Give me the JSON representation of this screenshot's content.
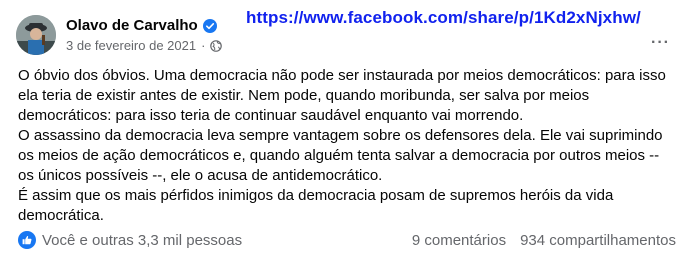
{
  "post": {
    "author": "Olavo de Carvalho",
    "date": "3 de fevereiro de 2021",
    "separator": "·",
    "more_label": "···",
    "paragraphs": [
      "O óbvio dos óbvios. Uma democracia não pode ser instaurada por meios democráticos: para isso ela teria de existir antes de existir. Nem pode, quando moribunda, ser salva por meios democráticos: para isso teria de continuar saudável enquanto vai morrendo.",
      "O assassino da democracia leva sempre vantagem sobre os defensores dela. Ele vai suprimindo os meios de ação democráticos e, quando alguém tenta salvar a democracia por outros meios -- os únicos possíveis --, ele o acusa de antidemocrático.",
      "É assim que os mais pérfidos inimigos da democracia posam de supremos heróis da vida democrática."
    ],
    "reactions": "Você e outras 3,3 mil pessoas",
    "comments": "9 comentários",
    "shares": "934 compartilhamentos"
  },
  "overlay_url": "https://www.facebook.com/share/p/1Kd2xNjxhw/",
  "icons": {
    "verified": "verified-badge-icon",
    "audience": "globe-icon",
    "reaction": "like-icon",
    "menu": "more-options-icon"
  },
  "colors": {
    "brand_blue": "#1877f2",
    "url_blue": "#1122ee",
    "secondary_text": "#65676b"
  }
}
